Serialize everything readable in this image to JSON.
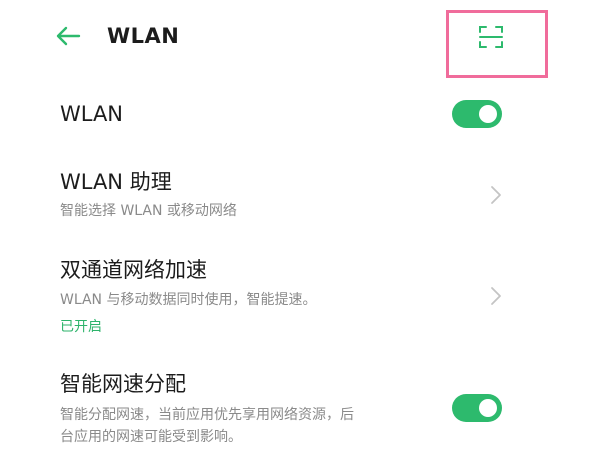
{
  "header": {
    "title": "WLAN",
    "back_icon": "arrow-left-icon",
    "scan_icon": "scan-qr-icon",
    "accent_color": "#2dba6d",
    "highlight_color": "#f06c9b"
  },
  "settings": {
    "wlan": {
      "title": "WLAN",
      "toggle_on": true
    },
    "assistant": {
      "title": "WLAN 助理",
      "subtitle": "智能选择 WLAN 或移动网络"
    },
    "dual_channel": {
      "title": "双通道网络加速",
      "subtitle": "WLAN 与移动数据同时使用，智能提速。",
      "status": "已开启"
    },
    "smart_allocation": {
      "title": "智能网速分配",
      "subtitle_line1": "智能分配网速，当前应用优先享用网络资源，后",
      "subtitle_line2": "台应用的网速可能受到影响。",
      "toggle_on": true
    }
  }
}
